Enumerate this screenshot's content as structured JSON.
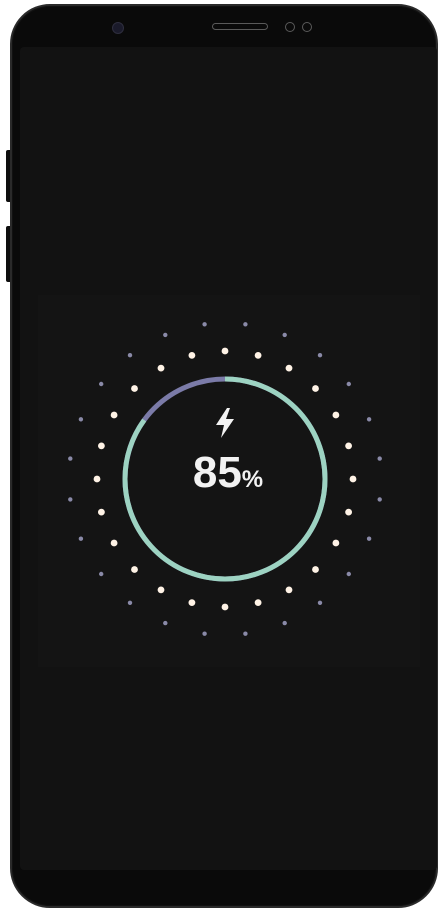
{
  "battery": {
    "level_number": "85",
    "level_symbol": "%",
    "level_fraction": 0.85,
    "icon": "lightning-bolt-icon",
    "state": "charging"
  },
  "colors": {
    "ring_charged": "#9dd3c2",
    "ring_remaining": "#7b7ba8",
    "dot_inner": "#fff3e6",
    "dot_outer": "#8a8aa8",
    "screen_background": "#121212"
  }
}
